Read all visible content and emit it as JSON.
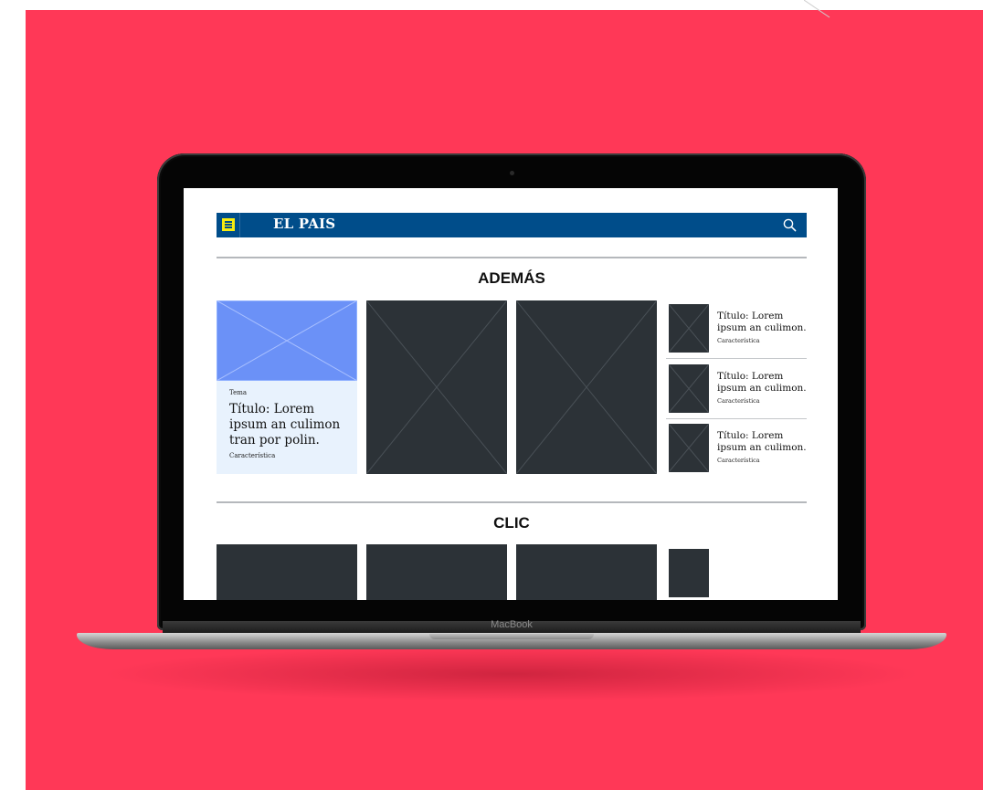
{
  "device": {
    "brand_label": "MacBook"
  },
  "navbar": {
    "logo_text": "EL PAIS",
    "menu_icon": "hamburger-menu-icon",
    "search_icon": "search-icon"
  },
  "sections": [
    {
      "title": "ADEMÁS",
      "featured": {
        "tema": "Tema",
        "title": "Título: Lorem ipsum an culimon tran por polin.",
        "caracteristica": "Característica"
      },
      "side_items": [
        {
          "title": "Título: Lorem ipsum an culimon.",
          "caracteristica": "Característica"
        },
        {
          "title": "Título: Lorem ipsum an culimon.",
          "caracteristica": "Característica"
        },
        {
          "title": "Título: Lorem ipsum an culimon.",
          "caracteristica": "Característica"
        }
      ]
    },
    {
      "title": "CLIC"
    }
  ],
  "colors": {
    "background": "#ff3857",
    "navbar": "#004d8a",
    "menu_accent": "#f6eb10",
    "placeholder_dark": "#2c3237",
    "placeholder_featured": "#6b91f7",
    "featured_card_bg": "#e8f2fd"
  }
}
